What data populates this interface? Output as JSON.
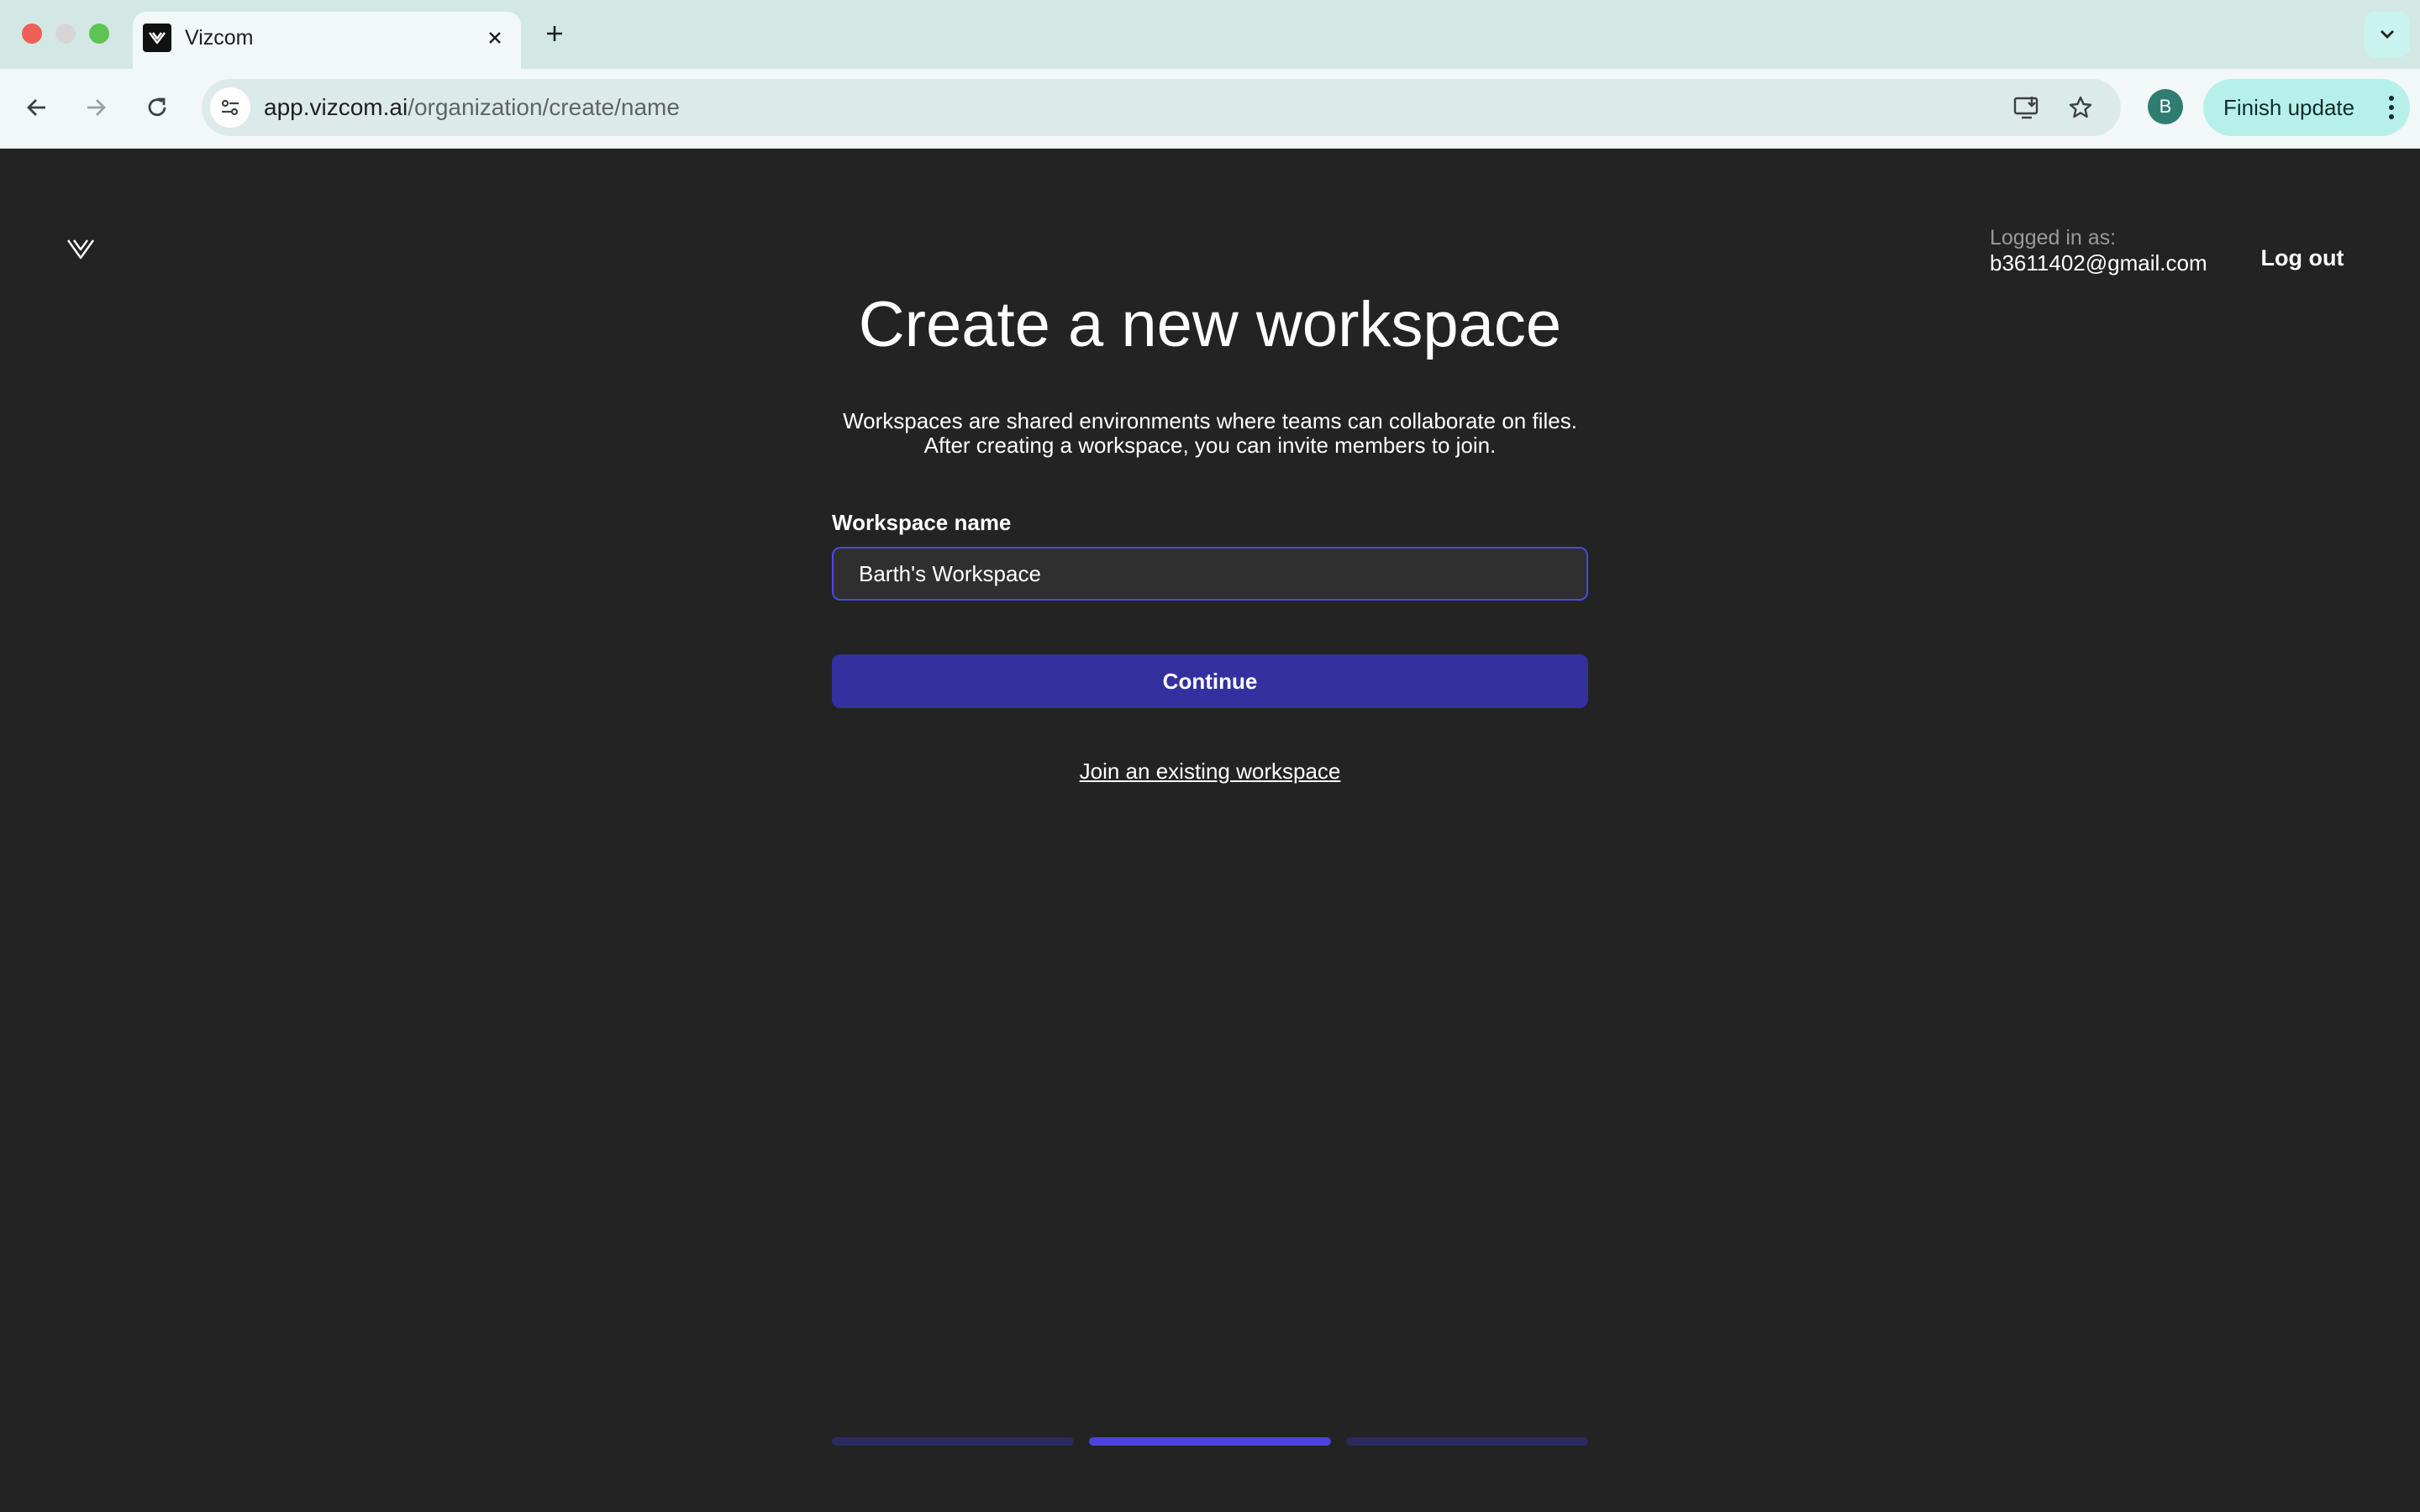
{
  "browser": {
    "tab_title": "Vizcom",
    "url_host": "app.vizcom.ai",
    "url_path": "/organization/create/name",
    "profile_initial": "B",
    "finish_update_label": "Finish update"
  },
  "header": {
    "logged_in_label": "Logged in as:",
    "email": "b3611402@gmail.com",
    "logout_label": "Log out"
  },
  "main": {
    "title": "Create a new workspace",
    "description_line1": "Workspaces are shared environments where teams can collaborate on files.",
    "description_line2": "After creating a workspace, you can invite members to join.",
    "field_label": "Workspace name",
    "field_value": "Barth's Workspace",
    "continue_label": "Continue",
    "join_link": "Join an existing workspace"
  },
  "progress": {
    "steps": 3,
    "current_step": 2
  },
  "colors": {
    "accent": "#3430a0",
    "progress_active": "#4a43dc",
    "background": "#232323"
  }
}
